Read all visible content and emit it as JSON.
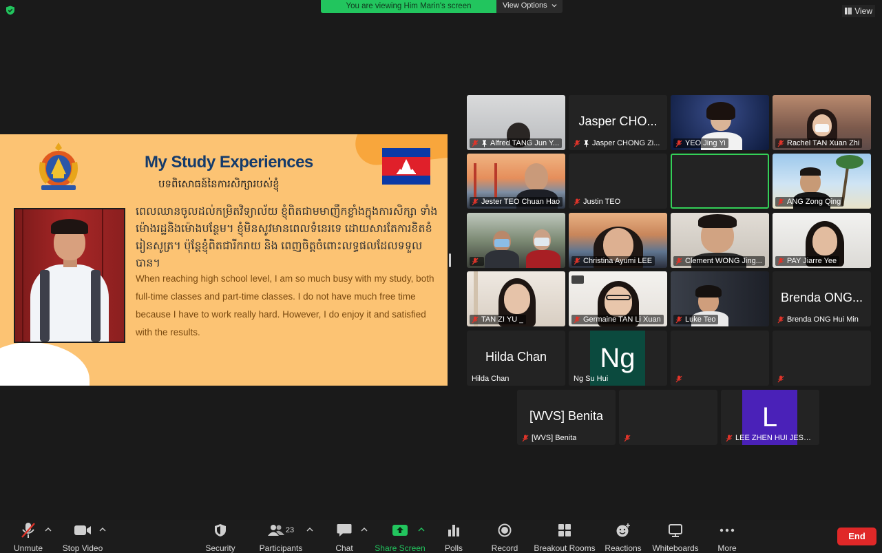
{
  "top_bar": {
    "banner_text": "You are viewing Him Marin's screen",
    "view_options_label": "View Options",
    "view_label": "View"
  },
  "slide": {
    "title": "My Study Experiences",
    "subtitle": "បទពិសោធន៍នៃការសិក្សារបស់ខ្ញុំ",
    "khmer_paragraph": "ពេលឈានចូលដល់កម្រិតវិទ្យាល័យ ខ្ញុំពិតជាមមាញឹកខ្លាំងក្នុងការសិក្សា ទាំងម៉ោងរដ្ឋនិងម៉ោងបន្ថែម។ ខ្ញុំមិនសូវមានពេលទំនេរទេ ដោយសារតែការខិតខំរៀនសូត្រ។ ប៉ុន្តែខ្ញុំពិតជារីករាយ និង ពេញចិត្តចំពោះលទ្ធផលដែលទទួលបាន។",
    "english_paragraph": "When reaching high school level, I am so much busy with my study, both full-time classes and part-time classes. I do not have much free time because I have to work really hard. However, I do enjoy it and satisfied with the results."
  },
  "participants": [
    {
      "name": "Alfred TANG Jun Y...",
      "center": "",
      "muted": true,
      "pinned": true
    },
    {
      "name": "Jasper CHONG Zi...",
      "center": "Jasper CHO...",
      "muted": true,
      "pinned": true
    },
    {
      "name": "YEO Jing Yi",
      "center": "",
      "muted": true,
      "pinned": false
    },
    {
      "name": "Rachel TAN Xuan Zhi",
      "center": "",
      "muted": true,
      "pinned": false
    },
    {
      "name": "Jester TEO Chuan Hao",
      "center": "",
      "muted": true,
      "pinned": false
    },
    {
      "name": "Justin TEO",
      "center": "",
      "muted": true,
      "pinned": false
    },
    {
      "name": "",
      "center": "",
      "muted": false,
      "pinned": false
    },
    {
      "name": "ANG Zong Qing",
      "center": "",
      "muted": true,
      "pinned": false
    },
    {
      "name": "",
      "center": "",
      "muted": true,
      "pinned": false
    },
    {
      "name": "Christina Ayumi LEE",
      "center": "",
      "muted": true,
      "pinned": false
    },
    {
      "name": "Clement WONG Jing...",
      "center": "",
      "muted": true,
      "pinned": false
    },
    {
      "name": "PAY Jiarre Yee",
      "center": "",
      "muted": true,
      "pinned": false
    },
    {
      "name": "TAN ZI YU _",
      "center": "",
      "muted": true,
      "pinned": false
    },
    {
      "name": "Germaine TAN Li Xuan",
      "center": "",
      "muted": true,
      "pinned": false
    },
    {
      "name": "Luke Teo",
      "center": "",
      "muted": true,
      "pinned": false
    },
    {
      "name": "Brenda ONG Hui Min",
      "center": "Brenda ONG...",
      "muted": true,
      "pinned": false
    },
    {
      "name": "Hilda Chan",
      "center": "Hilda Chan",
      "muted": false,
      "pinned": false
    },
    {
      "name": "Ng Su Hui",
      "center": "",
      "avatar": "Ng",
      "avatar_color": "#0b4a3e",
      "muted": false,
      "pinned": false
    },
    {
      "name": "",
      "center": "",
      "muted": true,
      "pinned": false
    },
    {
      "name": "",
      "center": "",
      "muted": true,
      "pinned": false
    },
    {
      "name": "[WVS] Benita",
      "center": "[WVS] Benita",
      "muted": true,
      "pinned": false
    },
    {
      "name": "",
      "center": "",
      "muted": true,
      "pinned": false
    },
    {
      "name": "LEE ZHEN HUI JESSI...",
      "center": "",
      "avatar": "L",
      "avatar_color": "#4a21b8",
      "muted": true,
      "pinned": false
    }
  ],
  "toolbar": {
    "unmute": "Unmute",
    "stop_video": "Stop Video",
    "security": "Security",
    "participants": "Participants",
    "participants_count": "23",
    "chat": "Chat",
    "share_screen": "Share Screen",
    "polls": "Polls",
    "record": "Record",
    "breakout_rooms": "Breakout Rooms",
    "reactions": "Reactions",
    "whiteboards": "Whiteboards",
    "more": "More",
    "end": "End"
  },
  "colors": {
    "banner_green": "#22c55e",
    "slide_bg": "#fcc373",
    "title_blue": "#153b6b",
    "end_red": "#e02828",
    "active_speaker": "#34d058",
    "muted_red": "#e0342a"
  }
}
